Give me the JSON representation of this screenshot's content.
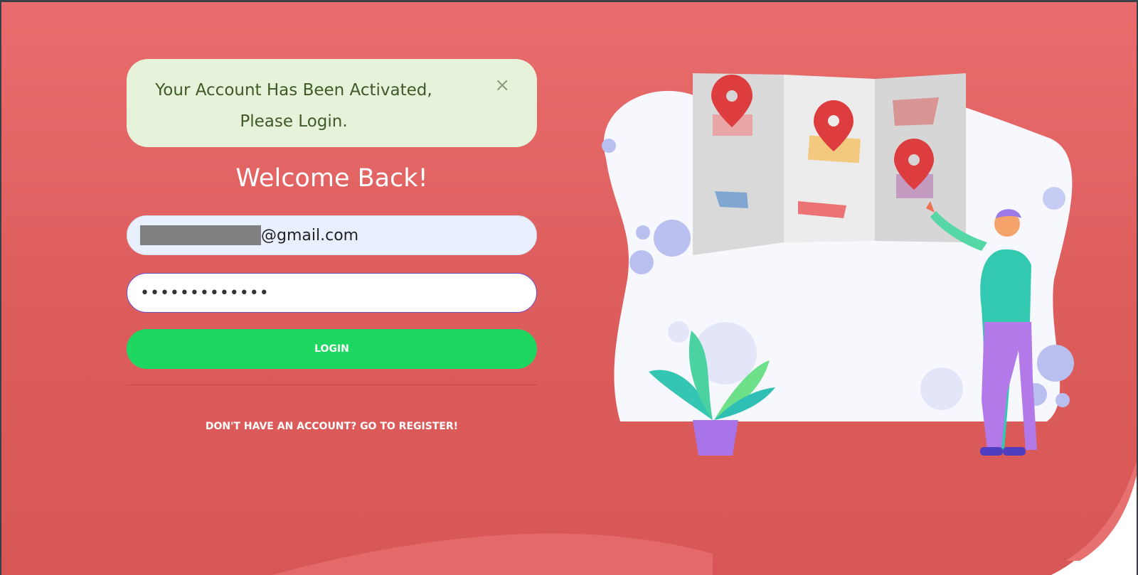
{
  "alert": {
    "line1": "Your Account Has Been Activated,",
    "line2": "Please Login.",
    "close_glyph": "×"
  },
  "welcome": "Welcome Back!",
  "email": {
    "suffix": "@gmail.com"
  },
  "password": {
    "dots": "•••••••••••••"
  },
  "login_label": "LOGIN",
  "register_link": "DON'T HAVE AN ACCOUNT? GO TO REGISTER!",
  "colors": {
    "background": "#dd5c5c",
    "alert_bg": "#e6f2da",
    "button": "#1ed760",
    "pin": "#dd3d3f"
  },
  "illustration": {
    "icons": [
      "map-icon",
      "location-pin-icon",
      "plant-icon",
      "person-icon"
    ]
  }
}
